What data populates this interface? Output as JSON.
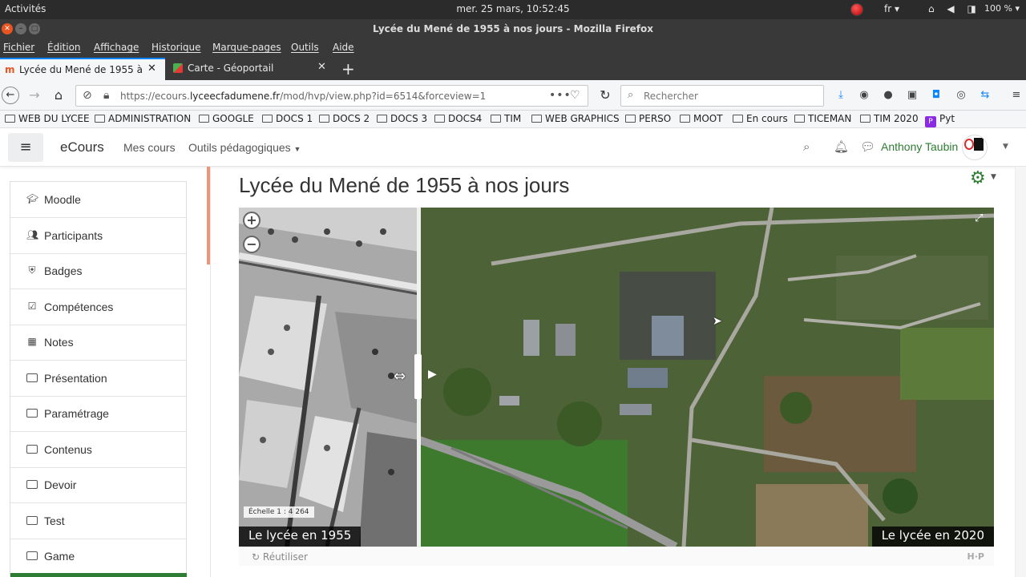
{
  "gnome": {
    "activities": "Activités",
    "clock": "mer. 25 mars, 10:52:45",
    "lang": "fr ▾",
    "battery": "100 % ▾"
  },
  "window": {
    "title": "Lycée du Mené de 1955 à nos jours - Mozilla Firefox"
  },
  "menu": {
    "items": [
      "Fichier",
      "Édition",
      "Affichage",
      "Historique",
      "Marque-pages",
      "Outils",
      "Aide"
    ]
  },
  "tabs": [
    {
      "label": "Lycée du Mené de 1955 à no",
      "active": true
    },
    {
      "label": "Carte - Géoportail",
      "active": false
    }
  ],
  "address": {
    "url_prefix": "https://ecours.",
    "url_domain": "lyceecfadumene.fr",
    "url_path": "/mod/hvp/view.php?id=6514&forceview=1",
    "search_placeholder": "Rechercher"
  },
  "bookmarks": [
    "WEB DU LYCEE",
    "ADMINISTRATION",
    "GOOGLE",
    "DOCS 1",
    "DOCS 2",
    "DOCS 3",
    "DOCS4",
    "TIM",
    "WEB GRAPHICS",
    "PERSO",
    "MOOT",
    "En cours",
    "TICEMAN",
    "TIM 2020",
    "Pyt"
  ],
  "moodle": {
    "brand": "eCours",
    "nav_mycourses": "Mes cours",
    "nav_tools": "Outils pédagogiques",
    "user": "Anthony Taubin"
  },
  "sidebar": {
    "items": [
      {
        "label": "Moodle",
        "icon": "graduation-cap-icon"
      },
      {
        "label": "Participants",
        "icon": "users-icon"
      },
      {
        "label": "Badges",
        "icon": "shield-icon"
      },
      {
        "label": "Compétences",
        "icon": "check-square-icon"
      },
      {
        "label": "Notes",
        "icon": "table-icon"
      },
      {
        "label": "Présentation",
        "icon": "folder-icon"
      },
      {
        "label": "Paramétrage",
        "icon": "folder-icon"
      },
      {
        "label": "Contenus",
        "icon": "folder-icon"
      },
      {
        "label": "Devoir",
        "icon": "folder-icon"
      },
      {
        "label": "Test",
        "icon": "folder-icon"
      },
      {
        "label": "Game",
        "icon": "folder-icon"
      }
    ]
  },
  "page": {
    "title": "Lycée du Mené de 1955 à nos jours"
  },
  "viewer": {
    "scale": "Échelle 1 : 4 264",
    "caption_left": "Le lycée en 1955",
    "caption_right": "Le lycée en 2020",
    "reuse": "Réutiliser",
    "brand": "H·P"
  },
  "colors": {
    "accent_green": "#2e7d32",
    "firefox_blue": "#0a84ff",
    "ubuntu_orange": "#e95420"
  }
}
